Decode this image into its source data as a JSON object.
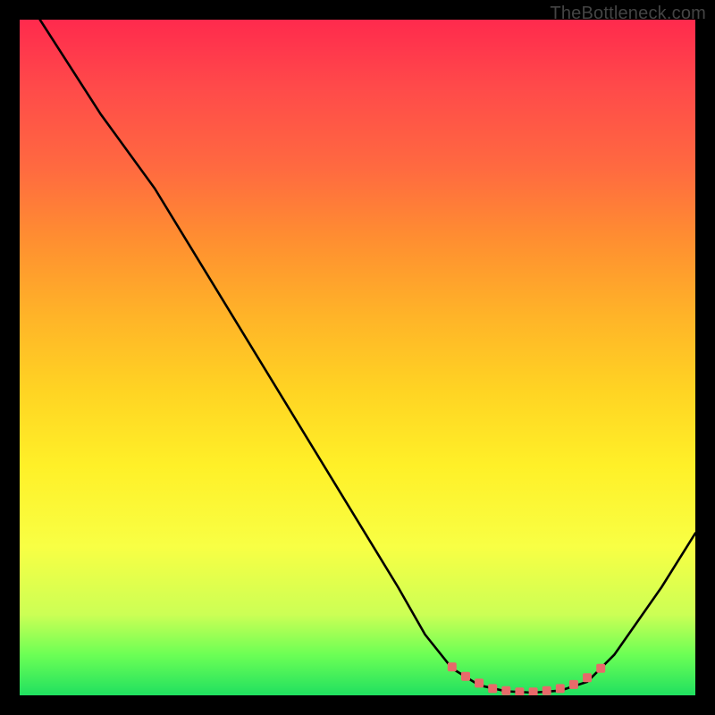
{
  "watermark": "TheBottleneck.com",
  "chart_data": {
    "type": "line",
    "title": "",
    "xlabel": "",
    "ylabel": "",
    "xlim": [
      0,
      100
    ],
    "ylim": [
      0,
      100
    ],
    "curve": [
      {
        "x": 3,
        "y": 100
      },
      {
        "x": 12,
        "y": 86
      },
      {
        "x": 20,
        "y": 75
      },
      {
        "x": 56,
        "y": 16
      },
      {
        "x": 60,
        "y": 9
      },
      {
        "x": 64,
        "y": 4
      },
      {
        "x": 68,
        "y": 1.5
      },
      {
        "x": 72,
        "y": 0.6
      },
      {
        "x": 76,
        "y": 0.4
      },
      {
        "x": 80,
        "y": 0.7
      },
      {
        "x": 84,
        "y": 2
      },
      {
        "x": 88,
        "y": 6
      },
      {
        "x": 95,
        "y": 16
      },
      {
        "x": 100,
        "y": 24
      }
    ],
    "markers": [
      {
        "x": 64,
        "y": 4.2
      },
      {
        "x": 66,
        "y": 2.8
      },
      {
        "x": 68,
        "y": 1.8
      },
      {
        "x": 70,
        "y": 1.0
      },
      {
        "x": 72,
        "y": 0.7
      },
      {
        "x": 74,
        "y": 0.5
      },
      {
        "x": 76,
        "y": 0.5
      },
      {
        "x": 78,
        "y": 0.7
      },
      {
        "x": 80,
        "y": 1.0
      },
      {
        "x": 82,
        "y": 1.6
      },
      {
        "x": 84,
        "y": 2.6
      },
      {
        "x": 86,
        "y": 4.0
      }
    ],
    "marker_color": "#e86a6a",
    "line_color": "#000000",
    "line_width": 2.6
  }
}
